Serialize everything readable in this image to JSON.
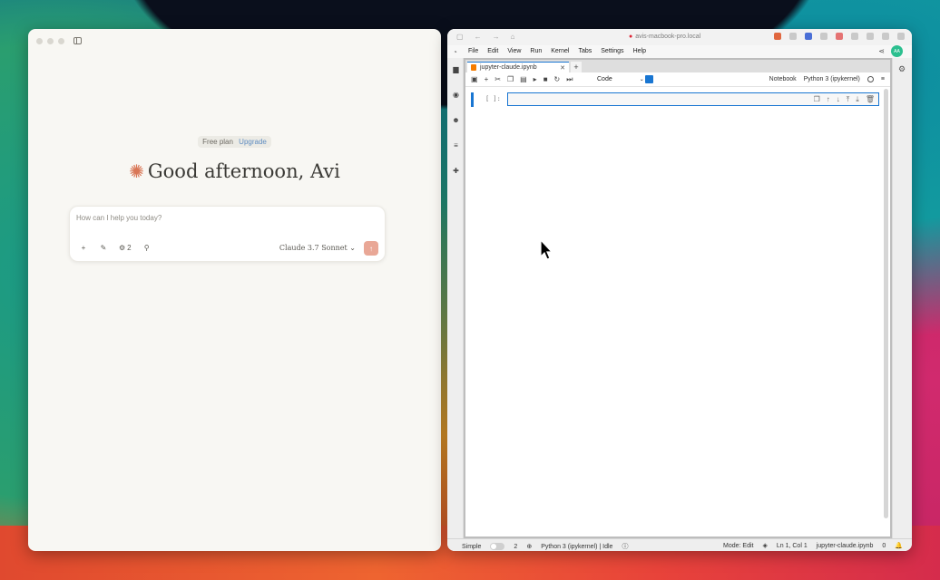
{
  "claude": {
    "plan_label": "Free plan",
    "upgrade_label": "Upgrade",
    "greeting": "Good afternoon, Avi",
    "composer_placeholder": "How can I help you today?",
    "tool_count": "2",
    "model_label": "Claude 3.7 Sonnet",
    "accent_color": "#d97757"
  },
  "browser": {
    "url": "avis-macbook-pro.local"
  },
  "jupyter": {
    "menus": [
      "File",
      "Edit",
      "View",
      "Run",
      "Kernel",
      "Tabs",
      "Settings",
      "Help"
    ],
    "avatar_initials": "AA",
    "tab_name": "jupyter-claude.ipynb",
    "cell_type": "Code",
    "notebook_label": "Notebook",
    "kernel_name": "Python 3 (ipykernel)",
    "cell_prompt": "[ ]:",
    "status": {
      "mode_label": "Simple",
      "count": "2",
      "kernel_status": "Python 3 (ipykernel) | Idle",
      "edit_mode": "Mode: Edit",
      "cursor_pos": "Ln 1, Col 1",
      "file_name": "jupyter-claude.ipynb",
      "notif_count": "0"
    },
    "accent_color": "#1976d2"
  }
}
